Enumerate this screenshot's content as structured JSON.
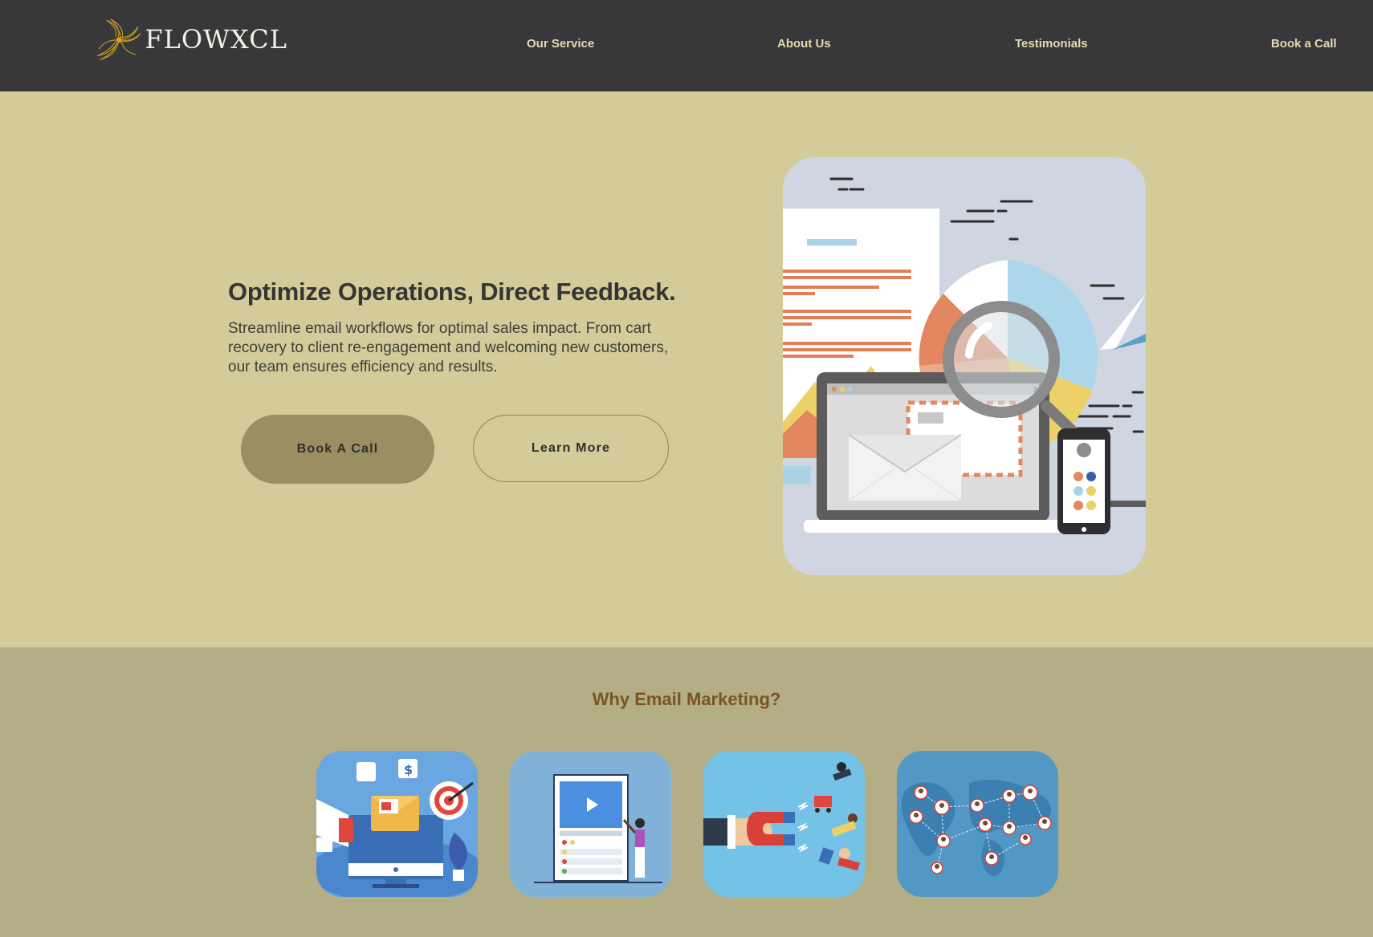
{
  "brand": {
    "name": "FLOWXCL",
    "logo_icon": "swirl-logo-icon",
    "gold": "#d9a520"
  },
  "nav": [
    {
      "label": "Our Service"
    },
    {
      "label": "About Us"
    },
    {
      "label": "Testimonials"
    },
    {
      "label": "Book a Call"
    }
  ],
  "hero": {
    "title": "Optimize Operations, Direct Feedback.",
    "description": "Streamline email workflows for optimal sales impact. From cart recovery to client re-engagement and welcoming new customers, our team ensures efficiency and results.",
    "primary_button": "Book A Call",
    "secondary_button": "Learn More",
    "illustration": "email-analytics-illustration"
  },
  "why": {
    "title": "Why Email Marketing?",
    "cards": [
      {
        "icon": "digital-marketing-illustration"
      },
      {
        "icon": "video-content-illustration"
      },
      {
        "icon": "customer-magnet-illustration"
      },
      {
        "icon": "global-network-illustration"
      }
    ]
  },
  "colors": {
    "header_bg": "#38383a",
    "hero_bg": "#d3cb9a",
    "section_bg": "#b3ae86",
    "nav_text": "#e3dab0",
    "primary_button_bg": "#998f62",
    "section_title": "#7a5522"
  }
}
